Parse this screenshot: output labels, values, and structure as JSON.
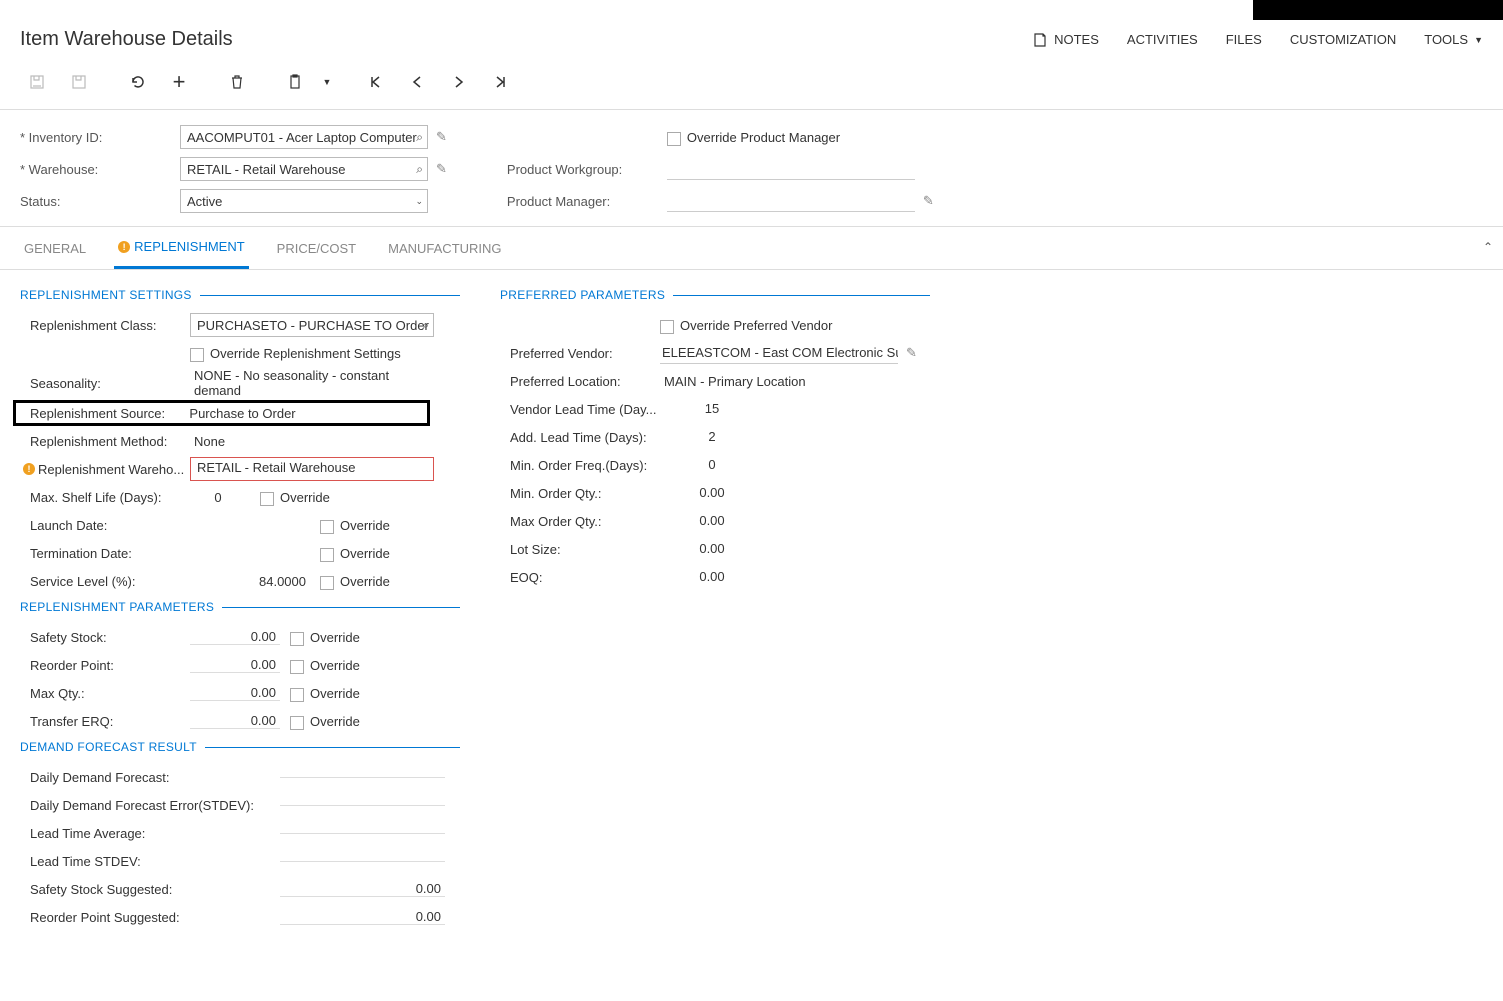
{
  "page": {
    "title": "Item Warehouse Details"
  },
  "topmenu": {
    "notes": "NOTES",
    "activities": "ACTIVITIES",
    "files": "FILES",
    "customization": "CUSTOMIZATION",
    "tools": "TOOLS"
  },
  "form": {
    "inventory_label": "Inventory ID:",
    "inventory_value": "AACOMPUT01 - Acer Laptop Computer",
    "warehouse_label": "Warehouse:",
    "warehouse_value": "RETAIL - Retail Warehouse",
    "status_label": "Status:",
    "status_value": "Active",
    "override_pm_label": "Override Product Manager",
    "product_workgroup_label": "Product Workgroup:",
    "product_workgroup_value": "",
    "product_manager_label": "Product Manager:",
    "product_manager_value": ""
  },
  "tabs": {
    "general": "GENERAL",
    "replenishment": "REPLENISHMENT",
    "pricecost": "PRICE/COST",
    "manufacturing": "MANUFACTURING"
  },
  "sections": {
    "repl_settings": "REPLENISHMENT SETTINGS",
    "repl_params": "REPLENISHMENT PARAMETERS",
    "demand_forecast": "DEMAND FORECAST RESULT",
    "pref_params": "PREFERRED PARAMETERS"
  },
  "repl": {
    "class_label": "Replenishment Class:",
    "class_value": "PURCHASETO - PURCHASE TO Order",
    "override_settings_label": "Override Replenishment Settings",
    "seasonality_label": "Seasonality:",
    "seasonality_value": "NONE - No seasonality - constant demand",
    "source_label": "Replenishment Source:",
    "source_value": "Purchase to Order",
    "method_label": "Replenishment Method:",
    "method_value": "None",
    "wh_label": "Replenishment Wareho...",
    "wh_value": "RETAIL - Retail Warehouse",
    "max_shelf_label": "Max. Shelf Life (Days):",
    "max_shelf_value": "0",
    "launch_label": "Launch Date:",
    "term_label": "Termination Date:",
    "service_label": "Service Level (%):",
    "service_value": "84.0000",
    "override_text": "Override"
  },
  "params": {
    "safety_label": "Safety Stock:",
    "safety_value": "0.00",
    "reorder_label": "Reorder Point:",
    "reorder_value": "0.00",
    "maxqty_label": "Max Qty.:",
    "maxqty_value": "0.00",
    "transfer_label": "Transfer ERQ:",
    "transfer_value": "0.00"
  },
  "demand": {
    "ddf_label": "Daily Demand Forecast:",
    "ddfe_label": "Daily Demand Forecast Error(STDEV):",
    "lta_label": "Lead Time Average:",
    "lts_label": "Lead Time STDEV:",
    "ss_sugg_label": "Safety Stock Suggested:",
    "ss_sugg_value": "0.00",
    "rp_sugg_label": "Reorder Point Suggested:",
    "rp_sugg_value": "0.00"
  },
  "pref": {
    "override_vendor_label": "Override Preferred Vendor",
    "pref_vendor_label": "Preferred Vendor:",
    "pref_vendor_value": "ELEEASTCOM - East COM Electronic Supply",
    "pref_loc_label": "Preferred Location:",
    "pref_loc_value": "MAIN - Primary Location",
    "vlt_label": "Vendor Lead Time (Day...",
    "vlt_value": "15",
    "alt_label": "Add. Lead Time (Days):",
    "alt_value": "2",
    "mof_label": "Min. Order Freq.(Days):",
    "mof_value": "0",
    "moq_label": "Min. Order Qty.:",
    "moq_value": "0.00",
    "maxoq_label": "Max Order Qty.:",
    "maxoq_value": "0.00",
    "lot_label": "Lot Size:",
    "lot_value": "0.00",
    "eoq_label": "EOQ:",
    "eoq_value": "0.00"
  }
}
